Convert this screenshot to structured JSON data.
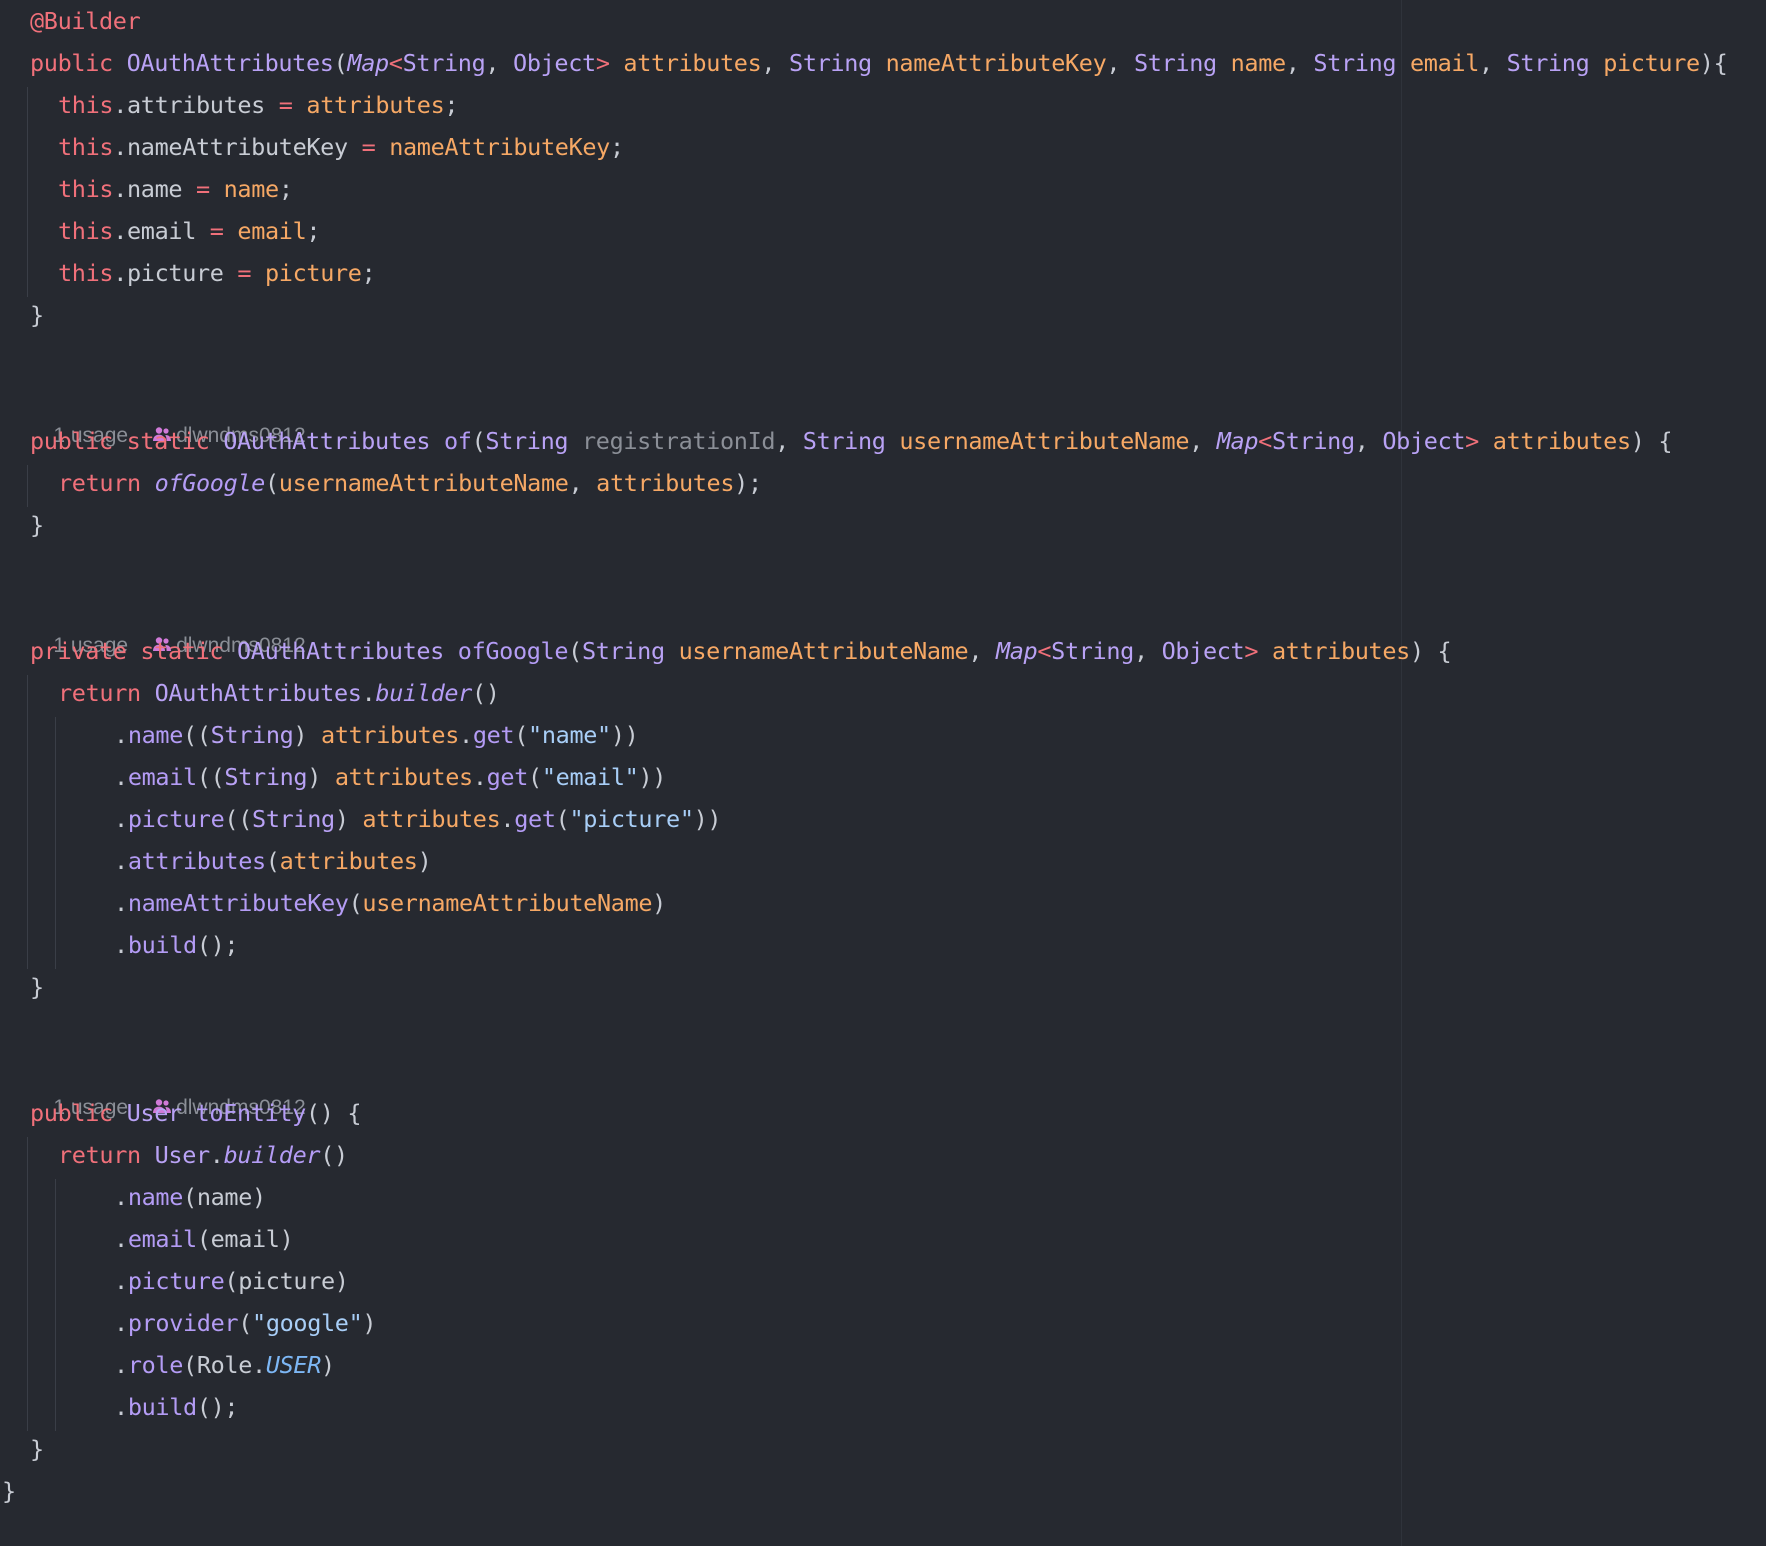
{
  "theme": {
    "background": "#262930",
    "colors": {
      "keyword": "#f0707a",
      "type": "#b9a2f5",
      "variable": "#f6a865",
      "string": "#a8cef7",
      "plain": "#c8ccd4",
      "dim": "#8b8f97",
      "method": "#b49cf5",
      "constant": "#7db7f5",
      "annotation": "#f0707a"
    }
  },
  "hints": [
    {
      "usage": "1 usage",
      "author_icon": "people-icon",
      "author": "dlwndms0812"
    },
    {
      "usage": "1 usage",
      "author_icon": "people-icon",
      "author": "dlwndms0812"
    },
    {
      "usage": "1 usage",
      "author_icon": "people-icon",
      "author": "dlwndms0812"
    }
  ],
  "code": [
    [
      [
        "annotation",
        "@Builder"
      ]
    ],
    [
      [
        "keyword",
        "public "
      ],
      [
        "type",
        "OAuthAttributes"
      ],
      [
        "plain",
        "("
      ],
      [
        "typei",
        "Map"
      ],
      [
        "keyword",
        "<"
      ],
      [
        "type",
        "String"
      ],
      [
        "plain",
        ", "
      ],
      [
        "type",
        "Object"
      ],
      [
        "keyword",
        "> "
      ],
      [
        "variable",
        "attributes"
      ],
      [
        "plain",
        ", "
      ],
      [
        "type",
        "String "
      ],
      [
        "variable",
        "nameAttributeKey"
      ],
      [
        "plain",
        ", "
      ],
      [
        "type",
        "String "
      ],
      [
        "variable",
        "name"
      ],
      [
        "plain",
        ", "
      ],
      [
        "type",
        "String "
      ],
      [
        "variable",
        "email"
      ],
      [
        "plain",
        ", "
      ],
      [
        "type",
        "String "
      ],
      [
        "variable",
        "picture"
      ],
      [
        "plain",
        "){"
      ]
    ],
    [
      [
        "keyword",
        "this"
      ],
      [
        "plain",
        ".attributes "
      ],
      [
        "keyword",
        "= "
      ],
      [
        "variable",
        "attributes"
      ],
      [
        "plain",
        ";"
      ]
    ],
    [
      [
        "keyword",
        "this"
      ],
      [
        "plain",
        ".nameAttributeKey "
      ],
      [
        "keyword",
        "= "
      ],
      [
        "variable",
        "nameAttributeKey"
      ],
      [
        "plain",
        ";"
      ]
    ],
    [
      [
        "keyword",
        "this"
      ],
      [
        "plain",
        ".name "
      ],
      [
        "keyword",
        "= "
      ],
      [
        "variable",
        "name"
      ],
      [
        "plain",
        ";"
      ]
    ],
    [
      [
        "keyword",
        "this"
      ],
      [
        "plain",
        ".email "
      ],
      [
        "keyword",
        "= "
      ],
      [
        "variable",
        "email"
      ],
      [
        "plain",
        ";"
      ]
    ],
    [
      [
        "keyword",
        "this"
      ],
      [
        "plain",
        ".picture "
      ],
      [
        "keyword",
        "= "
      ],
      [
        "variable",
        "picture"
      ],
      [
        "plain",
        ";"
      ]
    ],
    [
      [
        "plain",
        "}"
      ]
    ],
    [
      [
        "keyword",
        "public static "
      ],
      [
        "type",
        "OAuthAttributes "
      ],
      [
        "method",
        "of"
      ],
      [
        "plain",
        "("
      ],
      [
        "type",
        "String "
      ],
      [
        "dim",
        "registrationId"
      ],
      [
        "plain",
        ", "
      ],
      [
        "type",
        "String "
      ],
      [
        "variable",
        "usernameAttributeName"
      ],
      [
        "plain",
        ", "
      ],
      [
        "typei",
        "Map"
      ],
      [
        "keyword",
        "<"
      ],
      [
        "type",
        "String"
      ],
      [
        "plain",
        ", "
      ],
      [
        "type",
        "Object"
      ],
      [
        "keyword",
        "> "
      ],
      [
        "variable",
        "attributes"
      ],
      [
        "plain",
        ") {"
      ]
    ],
    [
      [
        "keyword",
        "return "
      ],
      [
        "methodi",
        "ofGoogle"
      ],
      [
        "plain",
        "("
      ],
      [
        "variable",
        "usernameAttributeName"
      ],
      [
        "plain",
        ", "
      ],
      [
        "variable",
        "attributes"
      ],
      [
        "plain",
        ");"
      ]
    ],
    [
      [
        "plain",
        "}"
      ]
    ],
    [
      [
        "keyword",
        "private static "
      ],
      [
        "type",
        "OAuthAttributes "
      ],
      [
        "method",
        "ofGoogle"
      ],
      [
        "plain",
        "("
      ],
      [
        "type",
        "String "
      ],
      [
        "variable",
        "usernameAttributeName"
      ],
      [
        "plain",
        ", "
      ],
      [
        "typei",
        "Map"
      ],
      [
        "keyword",
        "<"
      ],
      [
        "type",
        "String"
      ],
      [
        "plain",
        ", "
      ],
      [
        "type",
        "Object"
      ],
      [
        "keyword",
        "> "
      ],
      [
        "variable",
        "attributes"
      ],
      [
        "plain",
        ") {"
      ]
    ],
    [
      [
        "keyword",
        "return "
      ],
      [
        "type",
        "OAuthAttributes"
      ],
      [
        "plain",
        "."
      ],
      [
        "methodi",
        "builder"
      ],
      [
        "plain",
        "()"
      ]
    ],
    [
      [
        "plain",
        "."
      ],
      [
        "method",
        "name"
      ],
      [
        "plain",
        "(("
      ],
      [
        "type",
        "String"
      ],
      [
        "plain",
        ") "
      ],
      [
        "variable",
        "attributes"
      ],
      [
        "plain",
        "."
      ],
      [
        "method",
        "get"
      ],
      [
        "plain",
        "("
      ],
      [
        "string",
        "\"name\""
      ],
      [
        "plain",
        "))"
      ]
    ],
    [
      [
        "plain",
        "."
      ],
      [
        "method",
        "email"
      ],
      [
        "plain",
        "(("
      ],
      [
        "type",
        "String"
      ],
      [
        "plain",
        ") "
      ],
      [
        "variable",
        "attributes"
      ],
      [
        "plain",
        "."
      ],
      [
        "method",
        "get"
      ],
      [
        "plain",
        "("
      ],
      [
        "string",
        "\"email\""
      ],
      [
        "plain",
        "))"
      ]
    ],
    [
      [
        "plain",
        "."
      ],
      [
        "method",
        "picture"
      ],
      [
        "plain",
        "(("
      ],
      [
        "type",
        "String"
      ],
      [
        "plain",
        ") "
      ],
      [
        "variable",
        "attributes"
      ],
      [
        "plain",
        "."
      ],
      [
        "method",
        "get"
      ],
      [
        "plain",
        "("
      ],
      [
        "string",
        "\"picture\""
      ],
      [
        "plain",
        "))"
      ]
    ],
    [
      [
        "plain",
        "."
      ],
      [
        "method",
        "attributes"
      ],
      [
        "plain",
        "("
      ],
      [
        "variable",
        "attributes"
      ],
      [
        "plain",
        ")"
      ]
    ],
    [
      [
        "plain",
        "."
      ],
      [
        "method",
        "nameAttributeKey"
      ],
      [
        "plain",
        "("
      ],
      [
        "variable",
        "usernameAttributeName"
      ],
      [
        "plain",
        ")"
      ]
    ],
    [
      [
        "plain",
        "."
      ],
      [
        "method",
        "build"
      ],
      [
        "plain",
        "();"
      ]
    ],
    [
      [
        "plain",
        "}"
      ]
    ],
    [
      [
        "keyword",
        "public "
      ],
      [
        "type",
        "User "
      ],
      [
        "method",
        "toEntity"
      ],
      [
        "plain",
        "() {"
      ]
    ],
    [
      [
        "keyword",
        "return "
      ],
      [
        "type",
        "User"
      ],
      [
        "plain",
        "."
      ],
      [
        "methodi",
        "builder"
      ],
      [
        "plain",
        "()"
      ]
    ],
    [
      [
        "plain",
        "."
      ],
      [
        "method",
        "name"
      ],
      [
        "plain",
        "(name)"
      ]
    ],
    [
      [
        "plain",
        "."
      ],
      [
        "method",
        "email"
      ],
      [
        "plain",
        "(email)"
      ]
    ],
    [
      [
        "plain",
        "."
      ],
      [
        "method",
        "picture"
      ],
      [
        "plain",
        "(picture)"
      ]
    ],
    [
      [
        "plain",
        "."
      ],
      [
        "method",
        "provider"
      ],
      [
        "plain",
        "("
      ],
      [
        "string",
        "\"google\""
      ],
      [
        "plain",
        ")"
      ]
    ],
    [
      [
        "plain",
        "."
      ],
      [
        "method",
        "role"
      ],
      [
        "plain",
        "(Role."
      ],
      [
        "constanti",
        "USER"
      ],
      [
        "plain",
        ")"
      ]
    ],
    [
      [
        "plain",
        "."
      ],
      [
        "method",
        "build"
      ],
      [
        "plain",
        "();"
      ]
    ],
    [
      [
        "plain",
        "}"
      ]
    ],
    [
      [
        "plain",
        "}"
      ]
    ]
  ]
}
